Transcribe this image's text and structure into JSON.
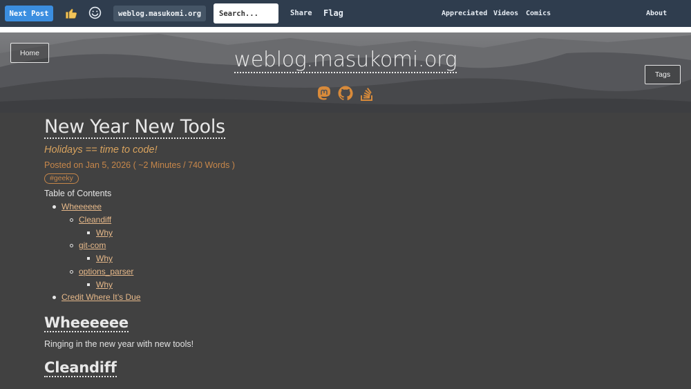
{
  "topbar": {
    "next_post": "Next Post",
    "domain": "weblog.masukomi.org",
    "search_placeholder": "Search...",
    "share": "Share",
    "flag": "Flag",
    "appreciated": "Appreciated",
    "videos": "Videos",
    "comics": "Comics",
    "about": "About",
    "icons": [
      "thumbs-up-icon",
      "smiley-icon"
    ]
  },
  "hero": {
    "home": "Home",
    "tags": "Tags",
    "site_title": "weblog.masukomi.org",
    "social_icons": [
      "mastodon-icon",
      "github-icon",
      "stack-overflow-icon"
    ],
    "icon_color": "#d88a3a"
  },
  "post": {
    "title": "New Year New Tools",
    "subtitle": "Holidays == time to code!",
    "posted": "Posted on Jan 5, 2026 ( ~2 Minutes / 740 Words )",
    "tag": "#geeky",
    "toc_title": "Table of Contents",
    "toc": [
      {
        "label": "Wheeeeee"
      },
      {
        "label": "Cleandiff"
      },
      {
        "label": "Why"
      },
      {
        "label": "git-com"
      },
      {
        "label": "Why"
      },
      {
        "label": "options_parser"
      },
      {
        "label": "Why"
      },
      {
        "label": "Credit Where It’s Due"
      }
    ],
    "heading1": "Wheeeeee",
    "para1": "Ringing in the new year with new tools!",
    "heading2": "Cleandiff"
  },
  "colors": {
    "topbar": "#2f3d4e",
    "button_blue": "#3b8ee0",
    "background": "#414141",
    "accent_orange": "#c7874a",
    "link": "#e7b98a"
  }
}
